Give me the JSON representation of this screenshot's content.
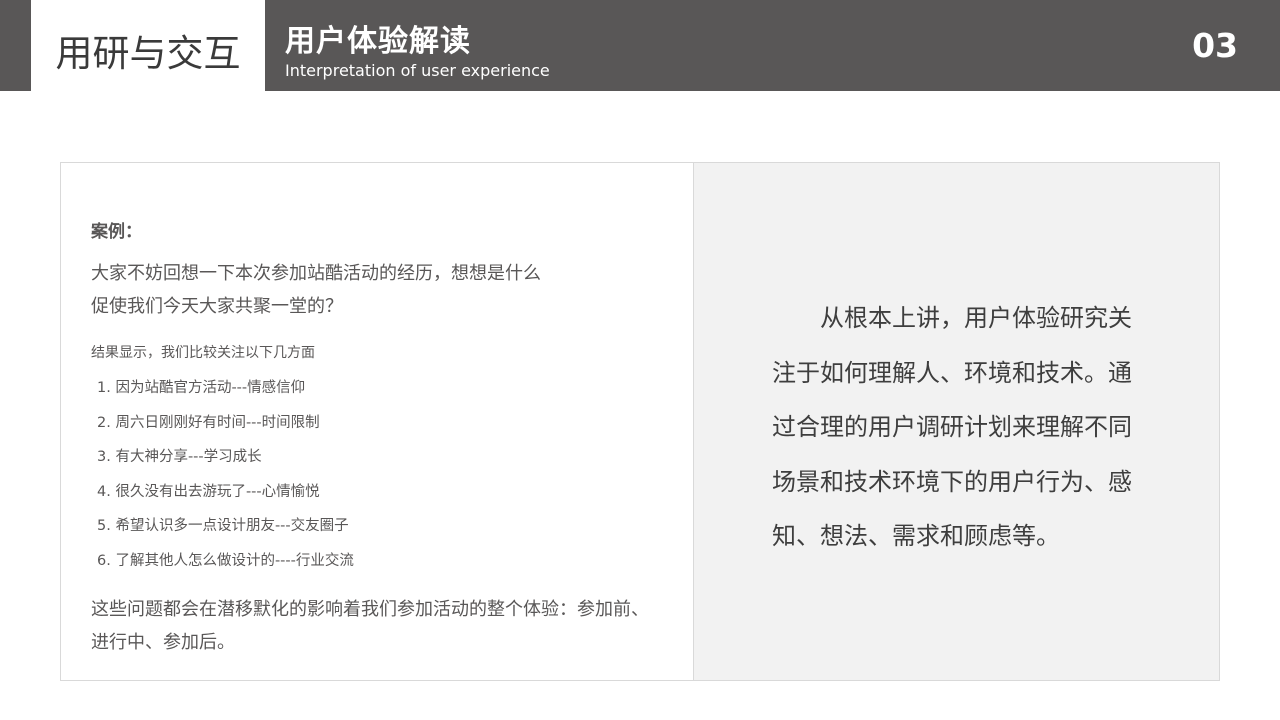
{
  "header": {
    "brand": "用研与交互",
    "title": "用户体验解读",
    "subtitle": "Interpretation of user experience",
    "page_number": "03"
  },
  "left_panel": {
    "case_label": "案例：",
    "question_line1": "大家不妨回想一下本次参加站酷活动的经历，想想是什么",
    "question_line2": "促使我们今天大家共聚一堂的？",
    "result_intro": "结果显示，我们比较关注以下几方面",
    "results": [
      "1. 因为站酷官方活动---情感信仰",
      "2. 周六日刚刚好有时间---时间限制",
      "3. 有大神分享---学习成长",
      "4. 很久没有出去游玩了---心情愉悦",
      "5. 希望认识多一点设计朋友---交友圈子",
      "6. 了解其他人怎么做设计的----行业交流"
    ],
    "conclusion": "这些问题都会在潜移默化的影响着我们参加活动的整个体验：参加前、进行中、参加后。"
  },
  "right_panel": {
    "text": "从根本上讲，用户体验研究关注于如何理解人、环境和技术。通过合理的用户调研计划来理解不同场景和技术环境下的用户行为、感知、想法、需求和顾虑等。"
  },
  "colors": {
    "header_bg": "#595757",
    "right_panel_bg": "#f2f2f2",
    "text": "#595757"
  }
}
